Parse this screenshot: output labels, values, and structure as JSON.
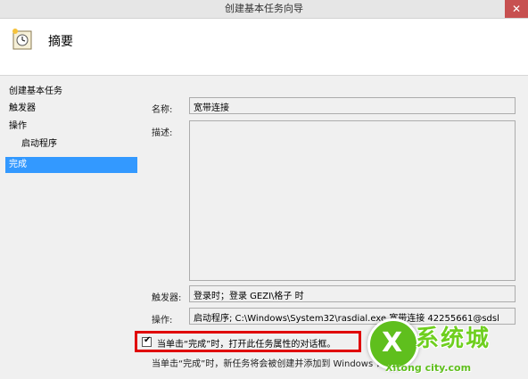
{
  "window": {
    "title": "创建基本任务向导",
    "close_glyph": "✕"
  },
  "header": {
    "title": "摘要",
    "icon": "clock-task-icon"
  },
  "sidebar": {
    "items": [
      {
        "label": "创建基本任务"
      },
      {
        "label": "触发器"
      },
      {
        "label": "操作"
      },
      {
        "label": "启动程序"
      },
      {
        "label": "完成"
      }
    ]
  },
  "form": {
    "name_label": "名称:",
    "name_value": "宽带连接",
    "desc_label": "描述:",
    "desc_value": "",
    "trigger_label": "触发器:",
    "trigger_value": "登录时；登录 GEZI\\格子 时",
    "action_label": "操作:",
    "action_value": "启动程序; C:\\Windows\\System32\\rasdial.exe 宽带连接 42255661@sdsl"
  },
  "checkbox": {
    "label": "当单击“完成”时，打开此任务属性的对话框。",
    "checked": true,
    "glyph": "✔"
  },
  "footer": {
    "text": "当单击“完成”时，新任务将会被创建并添加到 Windows 计划中。"
  },
  "watermark": {
    "glyph": "X",
    "brand": "系统城",
    "url": "Xitong city.com"
  },
  "colors": {
    "accent": "#3399ff",
    "highlight_border": "#e00000",
    "watermark_green": "#5fbf1d"
  }
}
